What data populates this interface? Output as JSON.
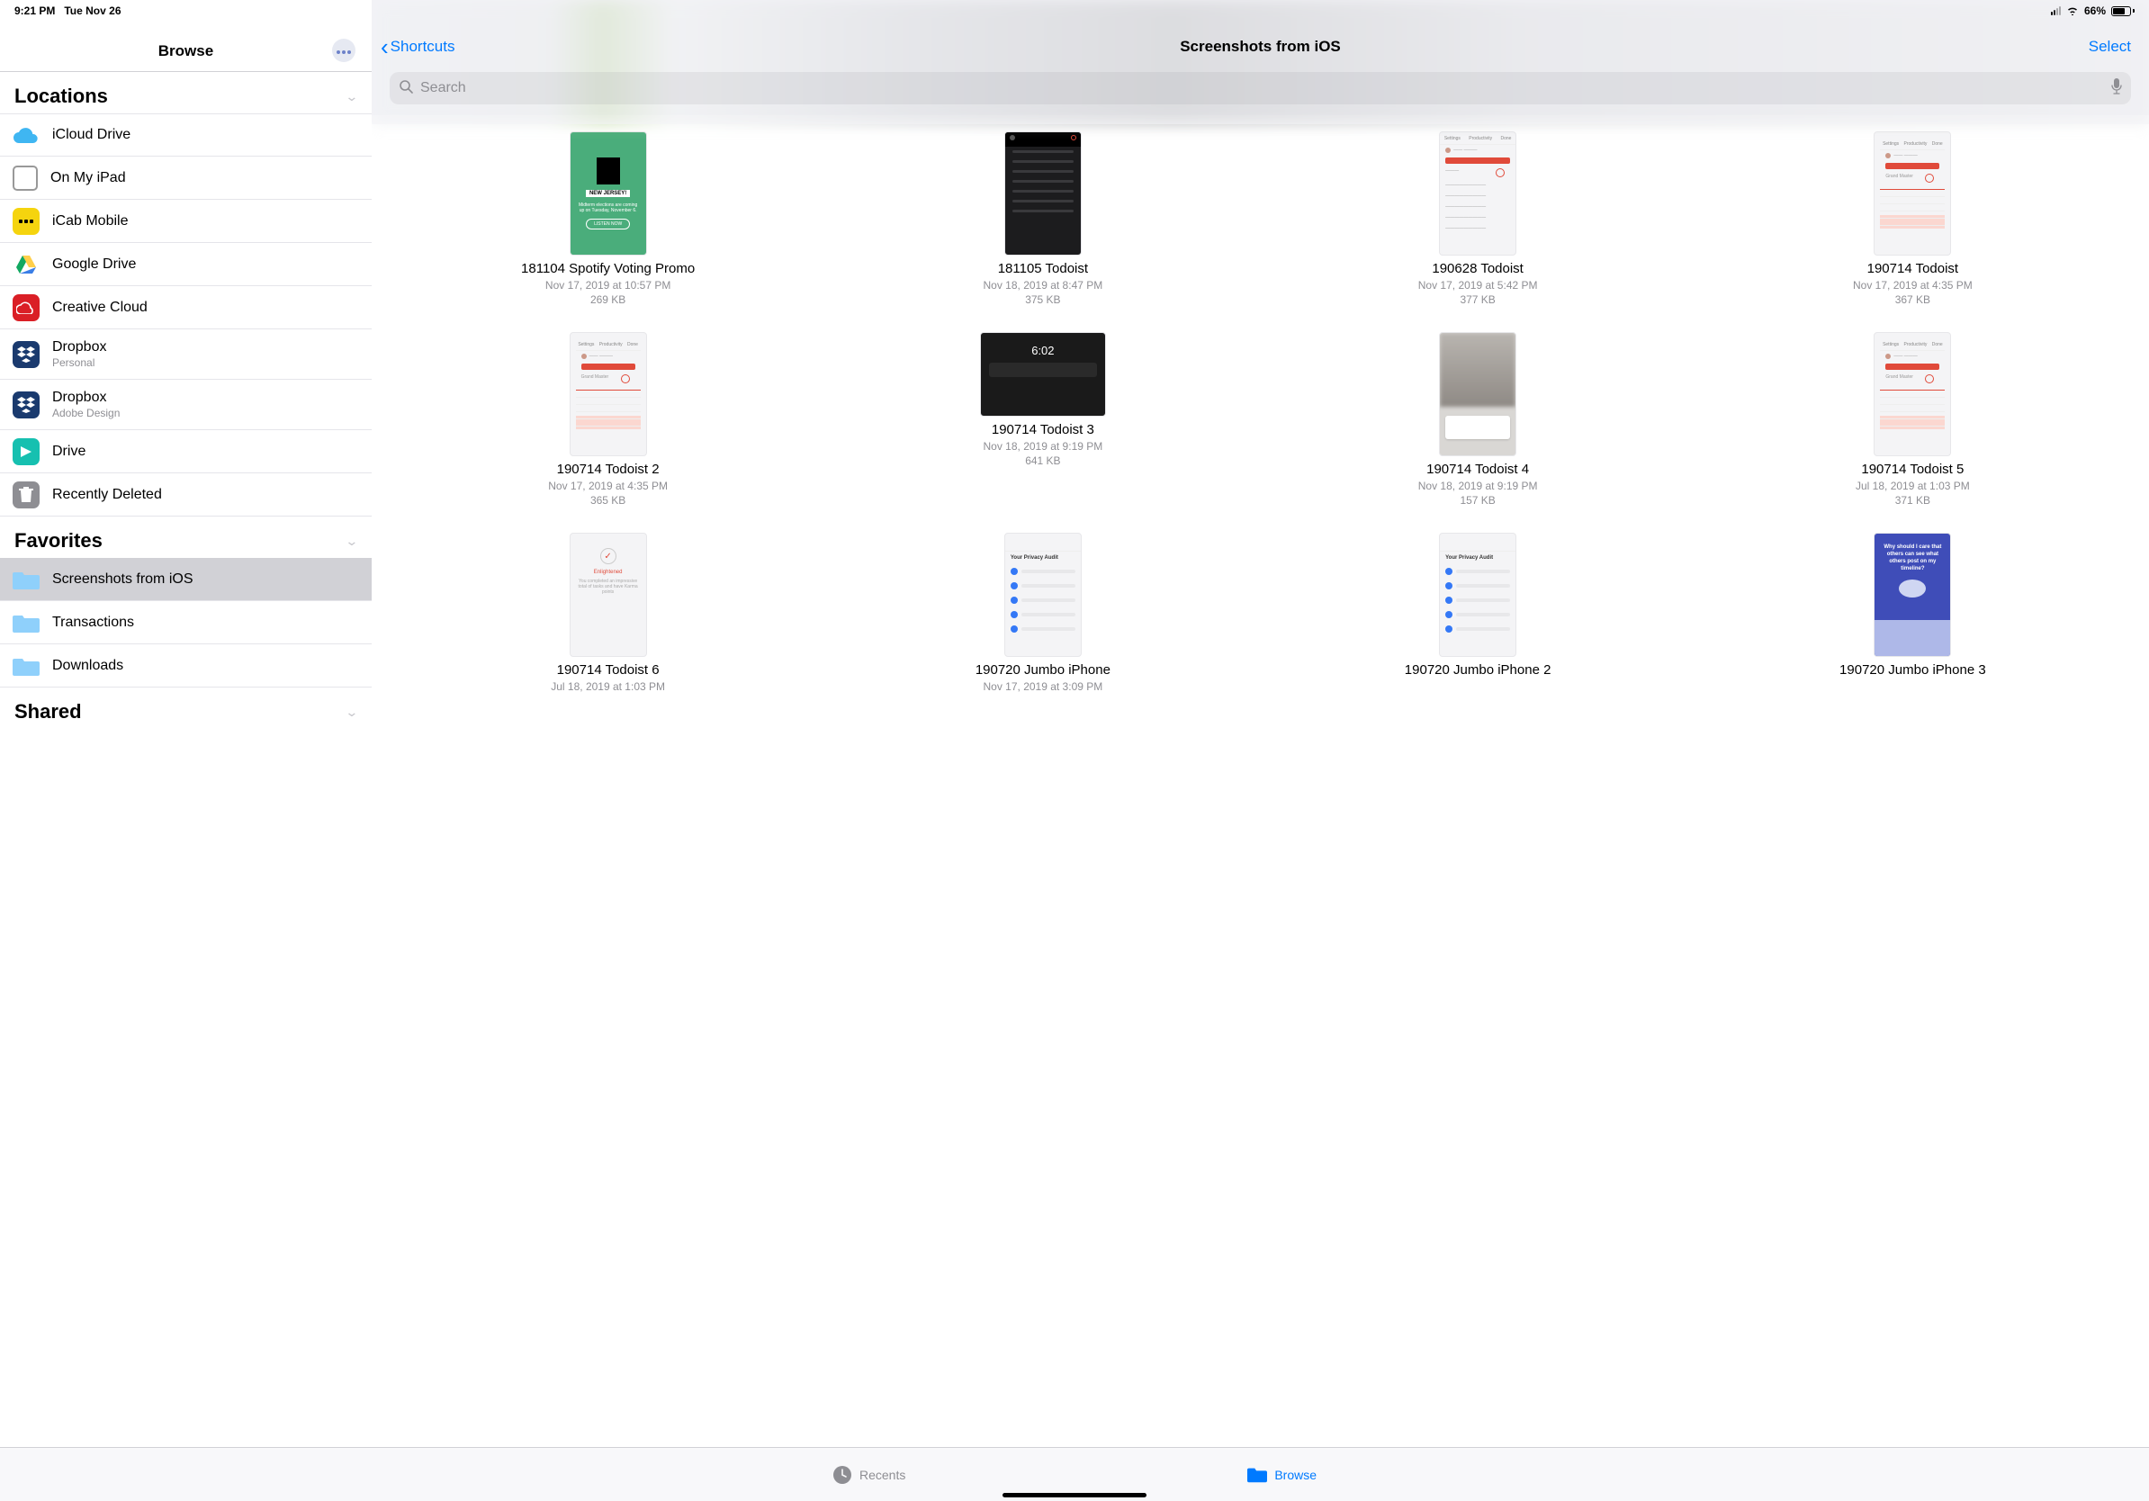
{
  "status": {
    "time": "9:21 PM",
    "date": "Tue Nov 26",
    "battery": "66%"
  },
  "sidebar": {
    "title": "Browse",
    "sections": {
      "locations": {
        "label": "Locations",
        "items": [
          {
            "label": "iCloud Drive"
          },
          {
            "label": "On My iPad"
          },
          {
            "label": "iCab Mobile"
          },
          {
            "label": "Google Drive"
          },
          {
            "label": "Creative Cloud"
          },
          {
            "label": "Dropbox",
            "sub": "Personal"
          },
          {
            "label": "Dropbox",
            "sub": "Adobe Design"
          },
          {
            "label": "Drive"
          },
          {
            "label": "Recently Deleted"
          }
        ]
      },
      "favorites": {
        "label": "Favorites",
        "items": [
          {
            "label": "Screenshots from iOS",
            "selected": true
          },
          {
            "label": "Transactions"
          },
          {
            "label": "Downloads"
          }
        ]
      },
      "shared": {
        "label": "Shared"
      }
    }
  },
  "main": {
    "back_label": "Shortcuts",
    "title": "Screenshots from iOS",
    "select_label": "Select",
    "search_placeholder": "Search"
  },
  "files": [
    {
      "name": "181104 Spotify Voting Promo",
      "date": "Nov 17, 2019 at 10:57 PM",
      "size": "269 KB",
      "thumb": "green"
    },
    {
      "name": "181105 Todoist",
      "date": "Nov 18, 2019 at 8:47 PM",
      "size": "375 KB",
      "thumb": "dark"
    },
    {
      "name": "190628 Todoist",
      "date": "Nov 17, 2019 at 5:42 PM",
      "size": "377 KB",
      "thumb": "light"
    },
    {
      "name": "190714 Todoist",
      "date": "Nov 17, 2019 at 4:35 PM",
      "size": "367 KB",
      "thumb": "chart"
    },
    {
      "name": "190714 Todoist 2",
      "date": "Nov 17, 2019 at 4:35 PM",
      "size": "365 KB",
      "thumb": "chart"
    },
    {
      "name": "190714 Todoist 3",
      "date": "Nov 18, 2019 at 9:19 PM",
      "size": "641 KB",
      "thumb": "lock"
    },
    {
      "name": "190714 Todoist 4",
      "date": "Nov 18, 2019 at 9:19 PM",
      "size": "157 KB",
      "thumb": "blur"
    },
    {
      "name": "190714 Todoist 5",
      "date": "Jul 18, 2019 at 1:03 PM",
      "size": "371 KB",
      "thumb": "chart"
    },
    {
      "name": "190714 Todoist 6",
      "date": "Jul 18, 2019 at 1:03 PM",
      "size": "",
      "thumb": "enlight"
    },
    {
      "name": "190720 Jumbo iPhone",
      "date": "Nov 17, 2019 at 3:09 PM",
      "size": "",
      "thumb": "jumbo"
    },
    {
      "name": "190720 Jumbo iPhone 2",
      "date": "",
      "size": "",
      "thumb": "jumbo"
    },
    {
      "name": "190720 Jumbo iPhone 3",
      "date": "",
      "size": "",
      "thumb": "purple"
    }
  ],
  "tabs": {
    "recents": "Recents",
    "browse": "Browse"
  }
}
